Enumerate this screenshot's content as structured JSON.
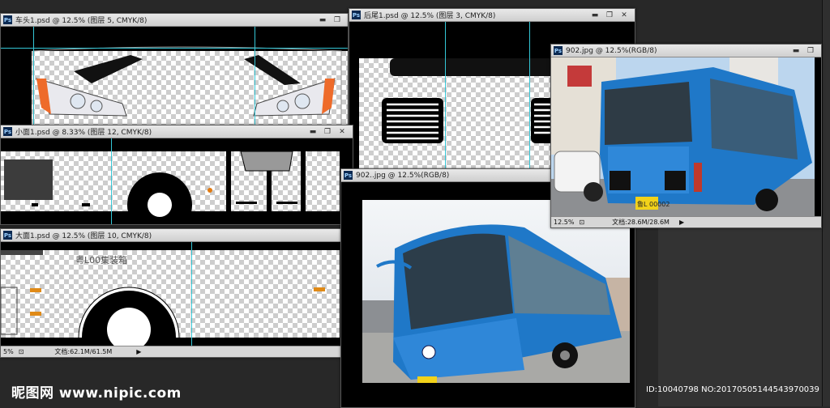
{
  "windows": {
    "chetou": {
      "title": "车头1.psd @ 12.5% (图层 5, CMYK/8)"
    },
    "houwei": {
      "title": "后尾1.psd @ 12.5% (图层 3, CMYK/8)"
    },
    "xiaomian": {
      "title": "小面1.psd @ 8.33% (图层 12, CMYK/8)"
    },
    "damian": {
      "title": "大面1.psd @ 12.5% (图层 10, CMYK/8)",
      "zoom": "5%",
      "doc": "文档:62.1M/61.5M",
      "bus_number": "粤L00集装箱"
    },
    "jpg_front": {
      "title": "902..jpg @ 12.5%(RGB/8)"
    },
    "jpg_back": {
      "title": "902.jpg @ 12.5%(RGB/8)",
      "zoom": "12.5%",
      "doc": "文档:28.6M/28.6M",
      "plate": "鲁L 00002"
    }
  },
  "controls": {
    "minimize": "▬",
    "restore": "❐",
    "close": "✕"
  },
  "watermark": {
    "site": "昵图网 www.nipic.com",
    "id": "ID:10040798 NO:20170505144543970039"
  },
  "colors": {
    "bus_blue": "#1f78c8",
    "guide": "#34c6d6",
    "sky": "#bcd6ee"
  }
}
